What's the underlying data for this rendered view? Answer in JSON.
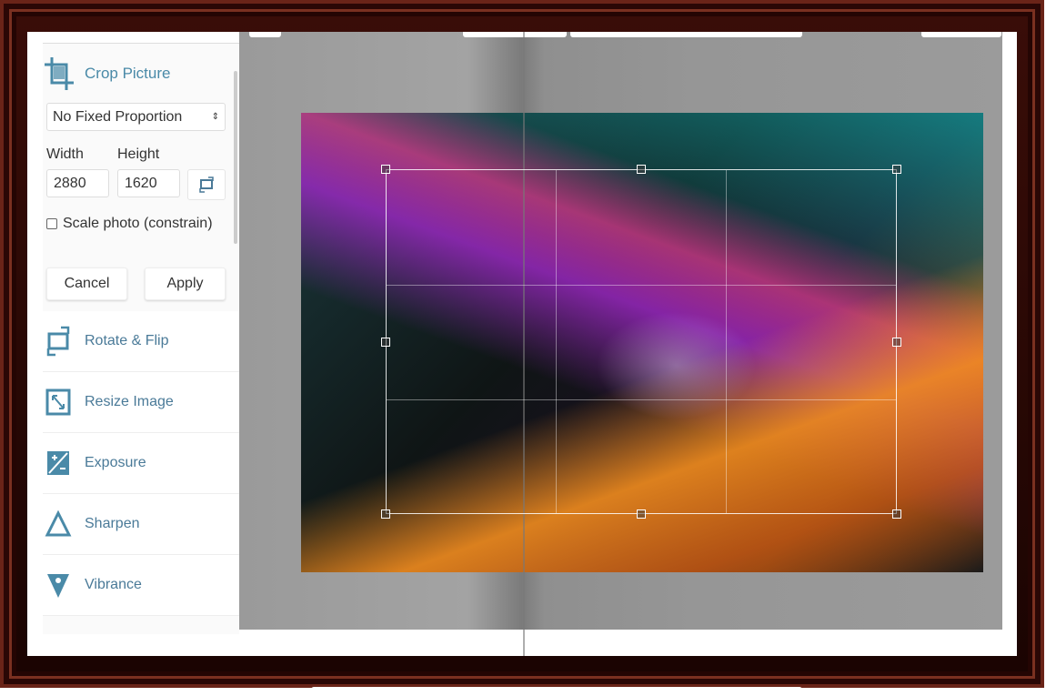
{
  "panel": {
    "title": "Crop Picture",
    "proportion": "No Fixed Proportion",
    "width_label": "Width",
    "height_label": "Height",
    "width_value": "2880",
    "height_value": "1620",
    "scale_label": "Scale photo (constrain)",
    "scale_checked": false,
    "cancel": "Cancel",
    "apply": "Apply"
  },
  "tools": [
    {
      "label": "Rotate & Flip",
      "icon": "rotate-icon"
    },
    {
      "label": "Resize Image",
      "icon": "resize-icon"
    },
    {
      "label": "Exposure",
      "icon": "exposure-icon"
    },
    {
      "label": "Sharpen",
      "icon": "sharpen-icon"
    },
    {
      "label": "Vibrance",
      "icon": "vibrance-icon"
    }
  ],
  "colors": {
    "accent": "#4a8aa8",
    "frame": "#3a0d08"
  }
}
